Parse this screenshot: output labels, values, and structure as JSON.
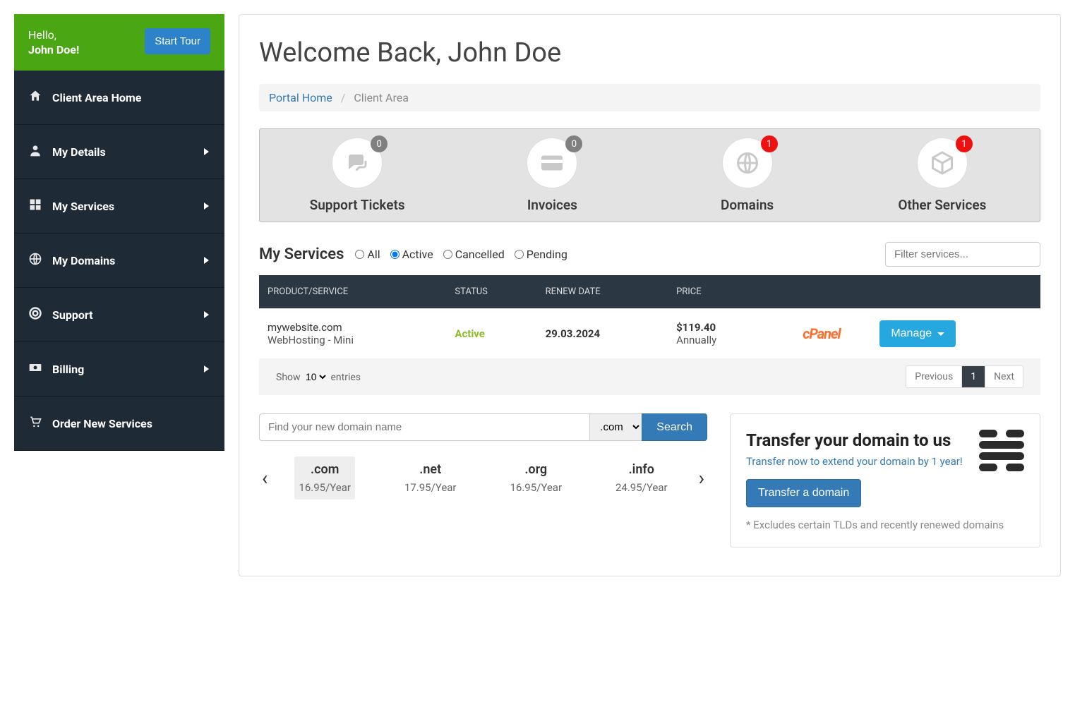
{
  "sidebar": {
    "greeting": "Hello,",
    "username": "John Doe!",
    "tour_button": "Start Tour",
    "items": [
      {
        "label": "Client Area Home",
        "icon": "home",
        "has_sub": false
      },
      {
        "label": "My Details",
        "icon": "user",
        "has_sub": true
      },
      {
        "label": "My Services",
        "icon": "grid",
        "has_sub": true
      },
      {
        "label": "My Domains",
        "icon": "globe",
        "has_sub": true
      },
      {
        "label": "Support",
        "icon": "lifebuoy",
        "has_sub": true
      },
      {
        "label": "Billing",
        "icon": "money",
        "has_sub": true
      },
      {
        "label": "Order New Services",
        "icon": "cart",
        "has_sub": false
      }
    ]
  },
  "header": {
    "welcome": "Welcome Back, John Doe"
  },
  "breadcrumb": {
    "home": "Portal Home",
    "current": "Client Area"
  },
  "stats": [
    {
      "label": "Support Tickets",
      "count": "0",
      "badge_style": "gray",
      "icon": "comments"
    },
    {
      "label": "Invoices",
      "count": "0",
      "badge_style": "gray",
      "icon": "card"
    },
    {
      "label": "Domains",
      "count": "1",
      "badge_style": "red",
      "icon": "globe"
    },
    {
      "label": "Other Services",
      "count": "1",
      "badge_style": "red",
      "icon": "box"
    }
  ],
  "services_panel": {
    "title": "My Services",
    "filters": {
      "all": "All",
      "active": "Active",
      "cancelled": "Cancelled",
      "pending": "Pending",
      "selected": "active"
    },
    "filter_placeholder": "Filter services...",
    "columns": {
      "product": "PRODUCT/SERVICE",
      "status": "STATUS",
      "renew": "RENEW DATE",
      "price": "PRICE"
    },
    "rows": [
      {
        "domain": "mywebsite.com",
        "plan": "WebHosting - Mini",
        "status": "Active",
        "renew": "29.03.2024",
        "price": "$119.40",
        "cycle": "Annually",
        "manage": "Manage"
      }
    ],
    "footer": {
      "show": "Show",
      "page_size": "10",
      "entries": "entries",
      "previous": "Previous",
      "page": "1",
      "next": "Next"
    }
  },
  "domain_search": {
    "placeholder": "Find your new domain name",
    "tld_selected": ".com",
    "button": "Search",
    "tlds": [
      {
        "ext": ".com",
        "price": "16.95/Year",
        "active": true
      },
      {
        "ext": ".net",
        "price": "17.95/Year",
        "active": false
      },
      {
        "ext": ".org",
        "price": "16.95/Year",
        "active": false
      },
      {
        "ext": ".info",
        "price": "24.95/Year",
        "active": false
      }
    ]
  },
  "transfer": {
    "title": "Transfer your domain to us",
    "subtitle": "Transfer now to extend your domain by 1 year!",
    "button": "Transfer a domain",
    "note": "* Excludes certain TLDs and recently renewed domains"
  }
}
